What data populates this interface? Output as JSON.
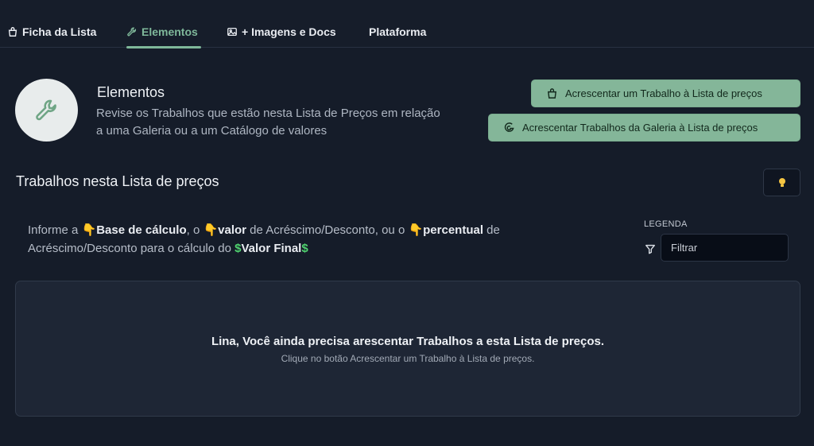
{
  "tabs": [
    {
      "label": "Ficha da Lista",
      "icon": "bag-icon"
    },
    {
      "label": "Elementos",
      "icon": "wrench-icon",
      "active": true
    },
    {
      "label": "+ Imagens e Docs",
      "icon": "image-icon"
    },
    {
      "label": "Plataforma",
      "icon": ""
    }
  ],
  "header": {
    "title": "Elementos",
    "description": "Revise os Trabalhos que estão nesta Lista de Preços em relação a uma Galeria ou a um Catálogo de valores",
    "icon": "wrench-icon"
  },
  "actions": {
    "add_one": "Acrescentar um Trabalho à Lista de preços",
    "add_gallery": "Acrescentar Trabalhos da Galeria à Lista de preços"
  },
  "section": {
    "title": "Trabalhos nesta Lista de preços"
  },
  "info": {
    "t1": "Informe a ",
    "hand": "👇",
    "b1": "Base de cálculo",
    "t2": ", o ",
    "b2": "valor",
    "t3": " de Acréscimo/Desconto, ou o ",
    "b3": "percentual",
    "t4": " de Acréscimo/Desconto para o cálculo do ",
    "dollar": "$",
    "b4": "Valor Final"
  },
  "legend": {
    "label": "LEGENDA",
    "filter_placeholder": "Filtrar",
    "filter_value": ""
  },
  "empty": {
    "title": "Lina, Você ainda precisa arescentar Trabalhos a esta Lista de preços.",
    "subtitle": "Clique no botão Acrescentar um Trabalho à Lista de preços."
  },
  "colors": {
    "background": "#151c29",
    "accent": "#7fb89a",
    "button": "#84b699",
    "hand": "#f0b429",
    "dollar": "#4fd16e"
  }
}
